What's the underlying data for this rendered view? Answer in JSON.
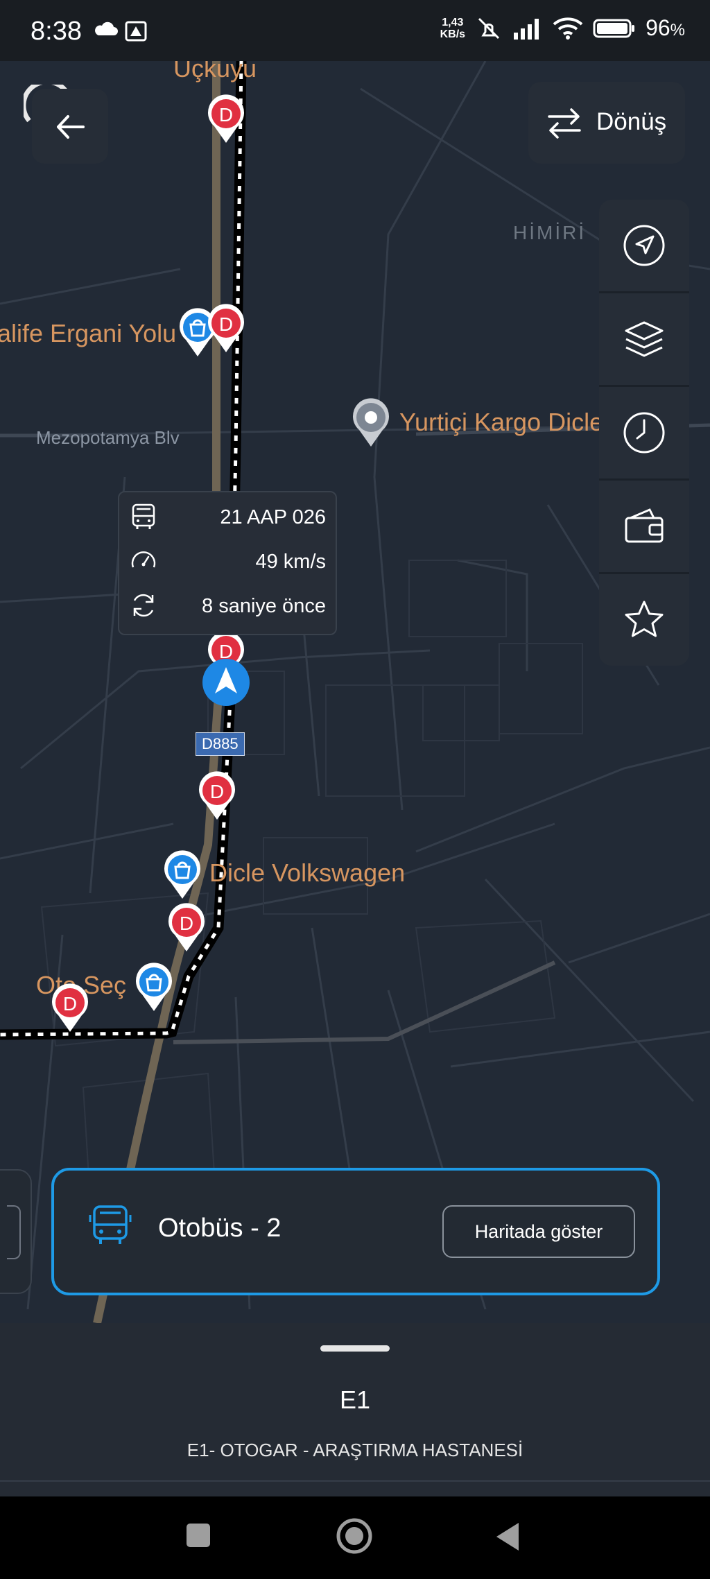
{
  "status_bar": {
    "time": "8:38",
    "net_speed_value": "1,43",
    "net_speed_unit": "KB/s",
    "battery": "96",
    "battery_unit": "%"
  },
  "map": {
    "place_labels": [
      "Uçkuyu",
      "alife Ergani Yolu",
      "Yurtiçi Kargo Dicle",
      "Dicle Volkswagen",
      "Oto Seç"
    ],
    "street_label": "Mezopotamya Blv",
    "district_label": "HİMİRİ",
    "road_shield": "D885",
    "stop_pin_letter": "D",
    "colors": {
      "route": "#ffffff",
      "stop_pin": "#e03041",
      "shop_pin": "#1e88e5",
      "vehicle": "#1e88e5",
      "label": "#d79660"
    }
  },
  "top_buttons": {
    "return_label": "Dönüş"
  },
  "side_toolbar": [
    "navigation-icon",
    "layers-icon",
    "clock-icon",
    "wallet-icon",
    "star-icon"
  ],
  "vehicle_popup": {
    "plate": "21 AAP 026",
    "speed": "49 km/s",
    "updated": "8 saniye önce"
  },
  "bus_card": {
    "name": "Otobüs - 2",
    "button": "Haritada göster"
  },
  "bottom_sheet": {
    "line_code": "E1",
    "line_description": "E1- OTOGAR - ARAŞTIRMA HASTANESİ"
  }
}
